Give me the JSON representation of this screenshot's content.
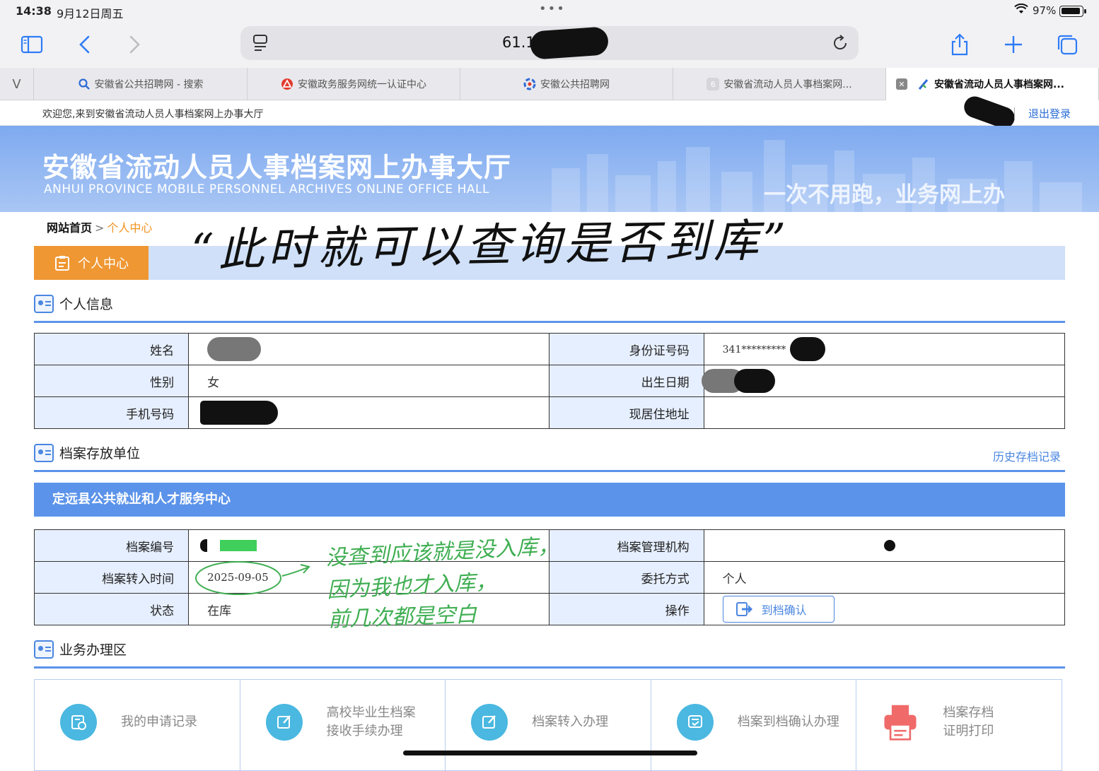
{
  "status": {
    "time": "14:38",
    "date": "9月12日周五",
    "battery": "97%"
  },
  "browser": {
    "url": "61.1",
    "tabs": [
      {
        "label": "安徽省公共招聘网 - 搜索",
        "icon": "search-icon"
      },
      {
        "label": "安徽政务服务网统一认证中心",
        "icon": "gov-logo-icon"
      },
      {
        "label": "安徽公共招聘网",
        "icon": "site-logo-icon"
      },
      {
        "label": "安徽省流动人员人事档案网...",
        "icon": "number-6-icon"
      },
      {
        "label": "安徽省流动人员人事档案网...",
        "icon": "feather-icon"
      }
    ],
    "first_tab_glyph": "V",
    "inactive_tab_badge": "6"
  },
  "site": {
    "welcome": "欢迎您,来到安徽省流动人员人事档案网上办事大厅",
    "logout": "退出登录",
    "banner_title": "安徽省流动人员人事档案网上办事大厅",
    "banner_sub": "ANHUI PROVINCE MOBILE PERSONNEL ARCHIVES ONLINE OFFICE HALL",
    "banner_slogan": "一次不用跑，业务网上办",
    "crumb_home": "网站首页",
    "crumb_sep": ">",
    "crumb_current": "个人中心",
    "center_tab": "个人中心"
  },
  "annotation_top": "“此时就可以查询是否到库”",
  "personal": {
    "heading": "个人信息",
    "name_label": "姓名",
    "id_label": "身份证号码",
    "id_value": "341*********",
    "gender_label": "性别",
    "gender_value": "女",
    "birth_label": "出生日期",
    "phone_label": "手机号码",
    "address_label": "现居住地址"
  },
  "archive": {
    "heading": "档案存放单位",
    "history_link": "历史存档记录",
    "org_name": "定远县公共就业和人才服务中心",
    "no_label": "档案编号",
    "mgmt_label": "档案管理机构",
    "transfer_time_label": "档案转入时间",
    "transfer_time_value": "2025-09-05",
    "entrust_label": "委托方式",
    "entrust_value": "个人",
    "state_label": "状态",
    "state_value": "在库",
    "op_label": "操作",
    "confirm_btn": "到档确认"
  },
  "annotation_green": {
    "line1": "没查到应该就是没入库，",
    "line2": "因为我也才入库，",
    "line3": "前几次都是空白"
  },
  "business": {
    "heading": "业务办理区",
    "items": [
      {
        "line1": "我的申请记录",
        "line2": "",
        "icon": "record-icon"
      },
      {
        "line1": "高校毕业生档案",
        "line2": "接收手续办理",
        "icon": "edit-icon"
      },
      {
        "line1": "档案转入办理",
        "line2": "",
        "icon": "edit-icon"
      },
      {
        "line1": "档案到档确认办理",
        "line2": "",
        "icon": "checklist-icon"
      },
      {
        "line1": "档案存档",
        "line2": "证明打印",
        "icon": "printer-icon"
      }
    ]
  },
  "colors": {
    "accent": "#5b93ea",
    "orange": "#ef9733",
    "green_note": "#3fae52"
  }
}
